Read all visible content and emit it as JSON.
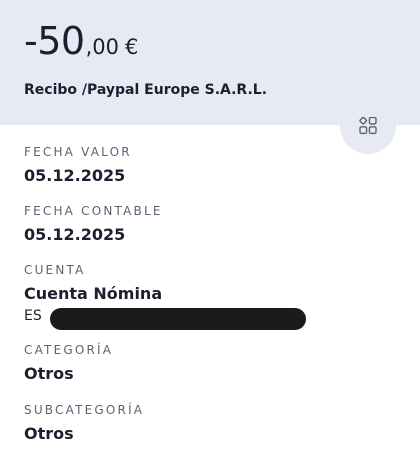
{
  "header": {
    "amount_integer": "-50",
    "amount_decimal": ",00",
    "currency": "€",
    "concept": "Recibo /Paypal Europe S.A.R.L."
  },
  "actions": {
    "more_icon": "grid-icon"
  },
  "fields": {
    "fecha_valor": {
      "label": "FECHA VALOR",
      "value": "05.12.2025"
    },
    "fecha_contable": {
      "label": "FECHA CONTABLE",
      "value": "05.12.2025"
    },
    "cuenta": {
      "label": "CUENTA",
      "value": "Cuenta Nómina",
      "iban_prefix": "ES"
    },
    "categoria": {
      "label": "CATEGORÍA",
      "value": "Otros"
    },
    "subcategoria": {
      "label": "SUBCATEGORÍA",
      "value": "Otros"
    }
  }
}
